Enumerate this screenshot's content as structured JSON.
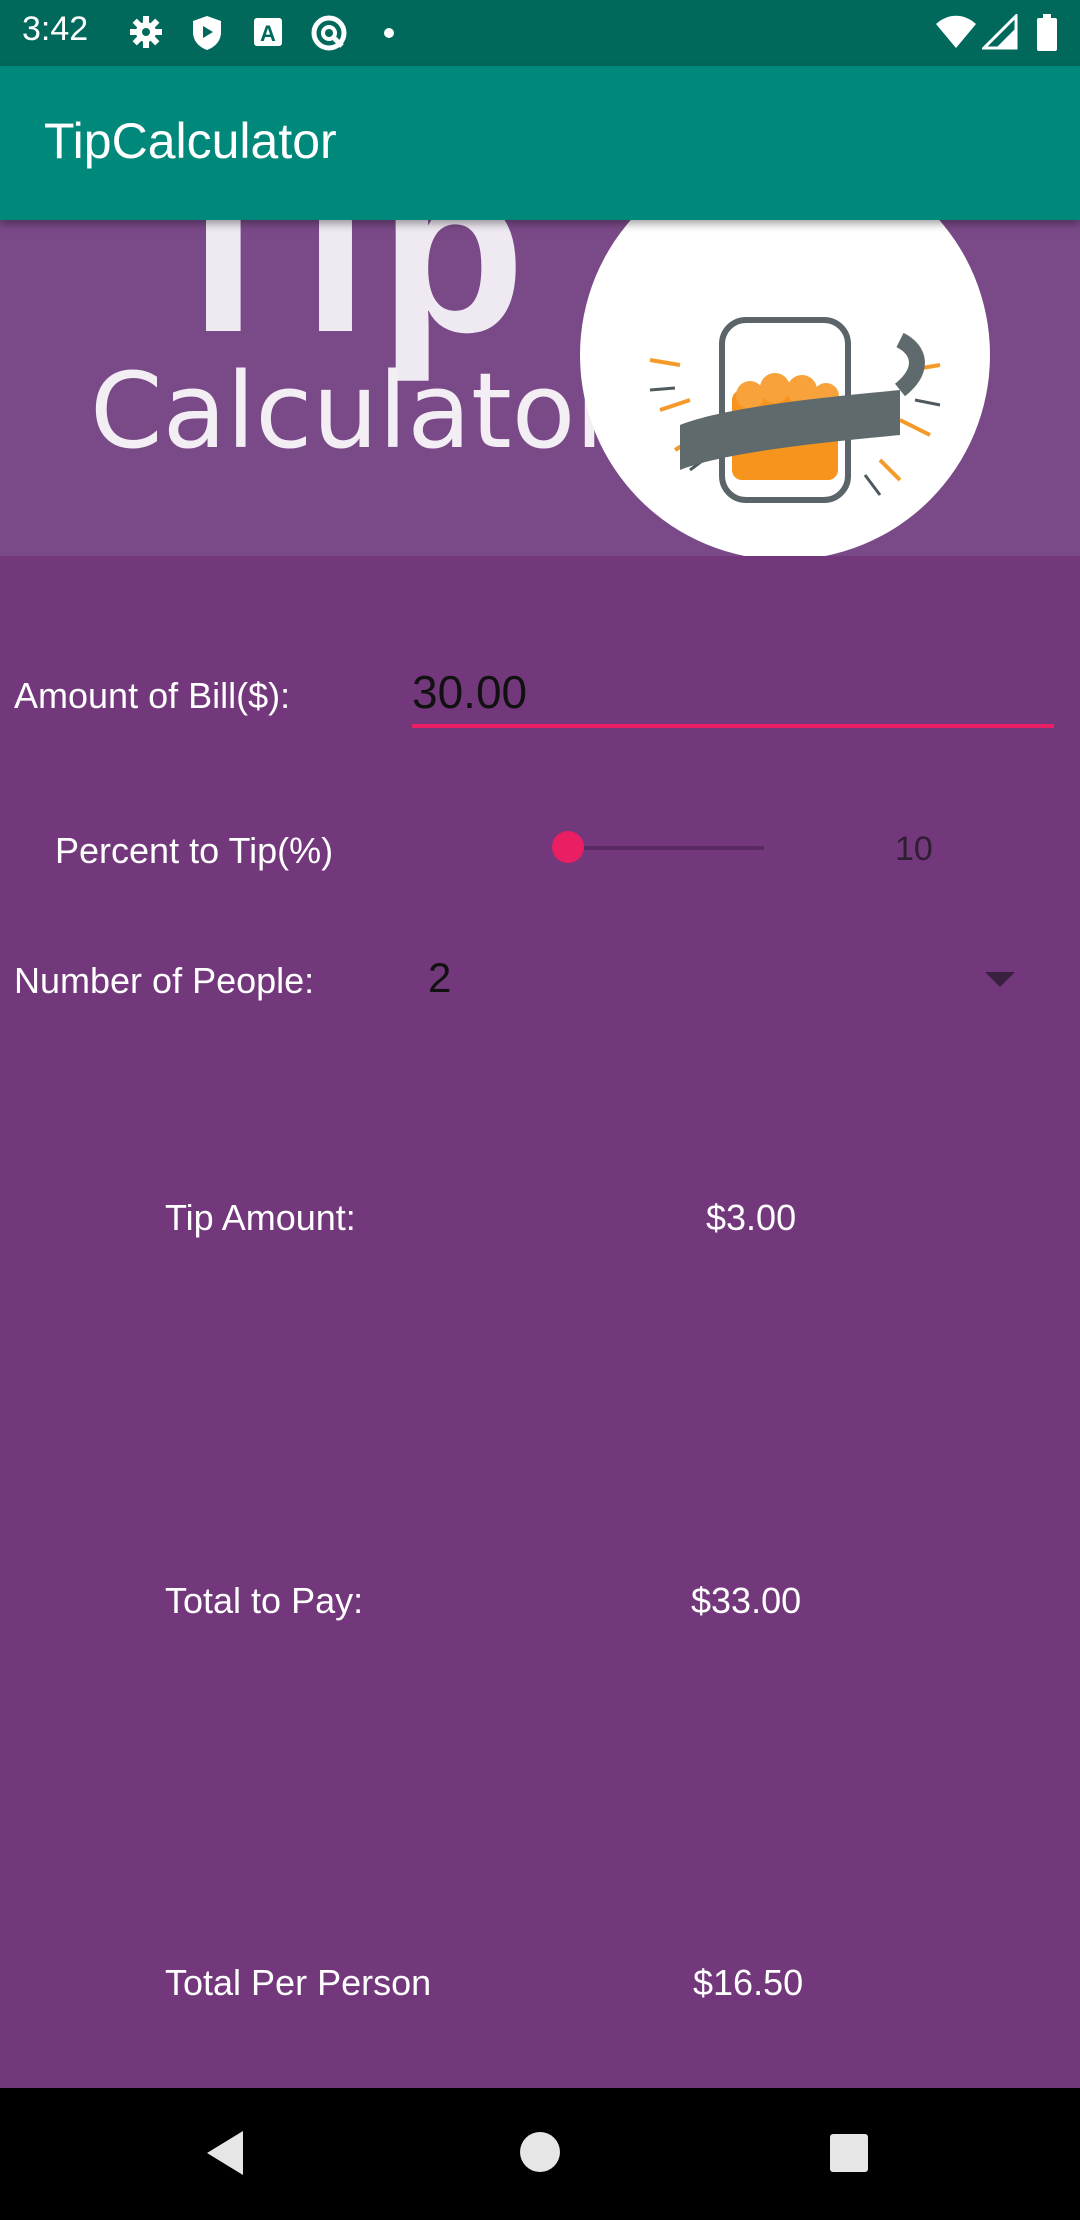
{
  "status_bar": {
    "time": "3:42",
    "icons": [
      "gear-icon",
      "shield-icon",
      "font-a-icon",
      "sync-icon",
      "dot-icon",
      "wifi-icon",
      "signal-icon",
      "battery-icon"
    ]
  },
  "app_bar": {
    "title": "TipCalculator"
  },
  "banner": {
    "tip_text": "Tip",
    "calc_text": "Calculator"
  },
  "form": {
    "bill_label": "Amount of Bill($):",
    "bill_value": "30.00",
    "tip_label": "Percent to Tip(%)",
    "tip_value": "10",
    "tip_level": 0.1,
    "people_label": "Number of People:",
    "people_value": "2"
  },
  "results": {
    "tip_label": "Tip Amount:",
    "tip_value": "$3.00",
    "total_label": "Total to Pay:",
    "total_value": "$33.00",
    "per_person_label": "Total Per Person",
    "per_person_value": "$16.50"
  },
  "nav_bar": {
    "icons": [
      "back-icon",
      "home-icon",
      "recents-icon"
    ]
  },
  "colors": {
    "app_bar": "#00897b",
    "status_bar": "#00695c",
    "background": "#73387c",
    "accent": "#e91e63"
  }
}
